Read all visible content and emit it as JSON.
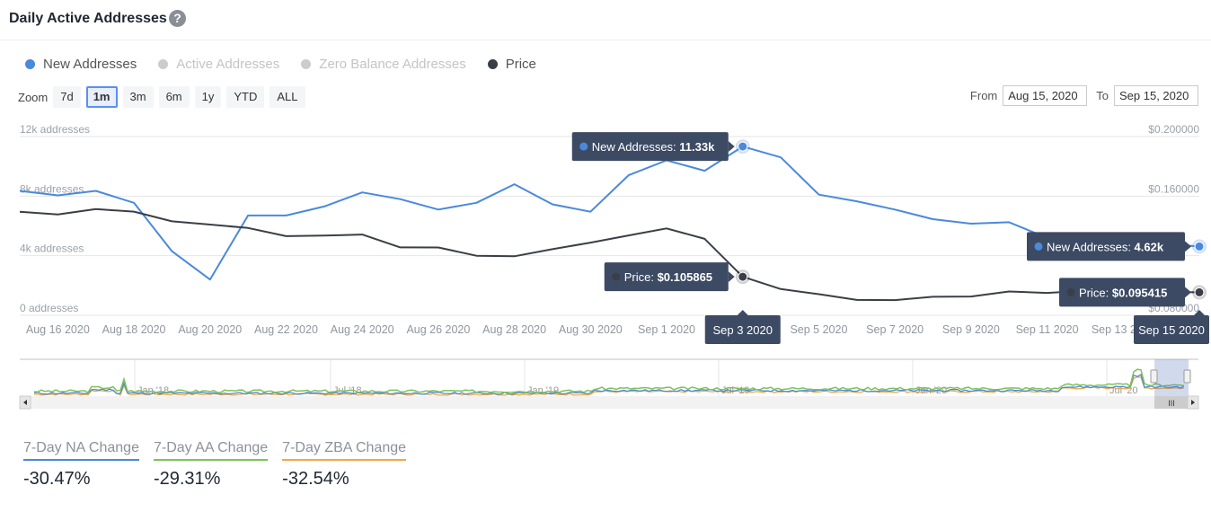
{
  "header": {
    "title": "Daily Active Addresses",
    "help_icon": "question-circle-icon"
  },
  "legend": [
    {
      "label": "New Addresses",
      "color": "#4a89dc",
      "active": true
    },
    {
      "label": "Active Addresses",
      "color": "#cccccc",
      "active": false
    },
    {
      "label": "Zero Balance Addresses",
      "color": "#cccccc",
      "active": false
    },
    {
      "label": "Price",
      "color": "#3a3f47",
      "active": true
    }
  ],
  "zoom": {
    "label": "Zoom",
    "buttons": [
      "7d",
      "1m",
      "3m",
      "6m",
      "1y",
      "YTD",
      "ALL"
    ],
    "active": "1m"
  },
  "range": {
    "from_label": "From",
    "from_value": "Aug 15, 2020",
    "to_label": "To",
    "to_value": "Sep 15, 2020"
  },
  "chart_data": {
    "type": "line",
    "title": "Daily Active Addresses",
    "x": [
      "Aug 15",
      "Aug 16",
      "Aug 17",
      "Aug 18",
      "Aug 19",
      "Aug 20",
      "Aug 21",
      "Aug 22",
      "Aug 23",
      "Aug 24",
      "Aug 25",
      "Aug 26",
      "Aug 27",
      "Aug 28",
      "Aug 29",
      "Aug 30",
      "Aug 31",
      "Sep 1",
      "Sep 2",
      "Sep 3",
      "Sep 4",
      "Sep 5",
      "Sep 6",
      "Sep 7",
      "Sep 8",
      "Sep 9",
      "Sep 10",
      "Sep 11",
      "Sep 12",
      "Sep 13",
      "Sep 14",
      "Sep 15"
    ],
    "x_tick_labels": [
      "Aug 16 2020",
      "Aug 18 2020",
      "Aug 20 2020",
      "Aug 22 2020",
      "Aug 24 2020",
      "Aug 26 2020",
      "Aug 28 2020",
      "Aug 30 2020",
      "Sep 1 2020",
      "Sep 3 2020",
      "Sep 5 2020",
      "Sep 7 2020",
      "Sep 9 2020",
      "Sep 11 2020",
      "Sep 13 2020",
      "Sep 15 2020"
    ],
    "series": [
      {
        "name": "New Addresses",
        "axis": "left",
        "color": "#4a89dc",
        "values": [
          8350,
          8050,
          8350,
          7550,
          4300,
          2400,
          6700,
          6700,
          7300,
          8250,
          7800,
          7100,
          7550,
          8800,
          7450,
          6950,
          9400,
          10400,
          9700,
          11330,
          10600,
          8100,
          7650,
          7100,
          6450,
          6150,
          6250,
          5200,
          4950,
          5000,
          4800,
          4620
        ]
      },
      {
        "name": "Price",
        "axis": "right",
        "color": "#3a3f47",
        "values": [
          0.1495,
          0.1477,
          0.1513,
          0.1496,
          0.1431,
          0.1409,
          0.1386,
          0.1331,
          0.1335,
          0.1342,
          0.1256,
          0.1255,
          0.12,
          0.1196,
          0.1244,
          0.1288,
          0.1336,
          0.1383,
          0.1313,
          0.105865,
          0.0976,
          0.0942,
          0.0903,
          0.0902,
          0.0924,
          0.0926,
          0.096,
          0.095,
          0.0965,
          0.0955,
          0.0956,
          0.095415
        ]
      }
    ],
    "y_left": {
      "ticks": [
        "0 addresses",
        "4k addresses",
        "8k addresses",
        "12k addresses"
      ],
      "range": [
        0,
        12000
      ]
    },
    "y_right": {
      "ticks": [
        "$0.080000",
        "$0.160000",
        "$0.200000"
      ],
      "range": [
        0.08,
        0.2
      ]
    },
    "grid": true,
    "legend_position": "top-left",
    "tooltips": [
      {
        "date": "Sep 3 2020",
        "new_addresses_label": "New Addresses: ",
        "new_addresses_value": "11.33k",
        "price_label": "Price: ",
        "price_value": "$0.105865"
      },
      {
        "date": "Sep 15 2020",
        "new_addresses_label": "New Addresses: ",
        "new_addresses_value": "4.62k",
        "price_label": "Price: ",
        "price_value": "$0.095415"
      }
    ],
    "navigator": {
      "tick_labels": [
        "Jan '18",
        "Jul '18",
        "Jan '19",
        "Jul '19",
        "Jan '20",
        "Jul '20"
      ],
      "selected_range": [
        "Aug 15, 2020",
        "Sep 15, 2020"
      ]
    }
  },
  "stats": [
    {
      "label": "7-Day NA Change",
      "value": "-30.47%",
      "color": "#4a89dc"
    },
    {
      "label": "7-Day AA Change",
      "value": "-29.31%",
      "color": "#7cc35a"
    },
    {
      "label": "7-Day ZBA Change",
      "value": "-32.54%",
      "color": "#f0a848"
    }
  ]
}
